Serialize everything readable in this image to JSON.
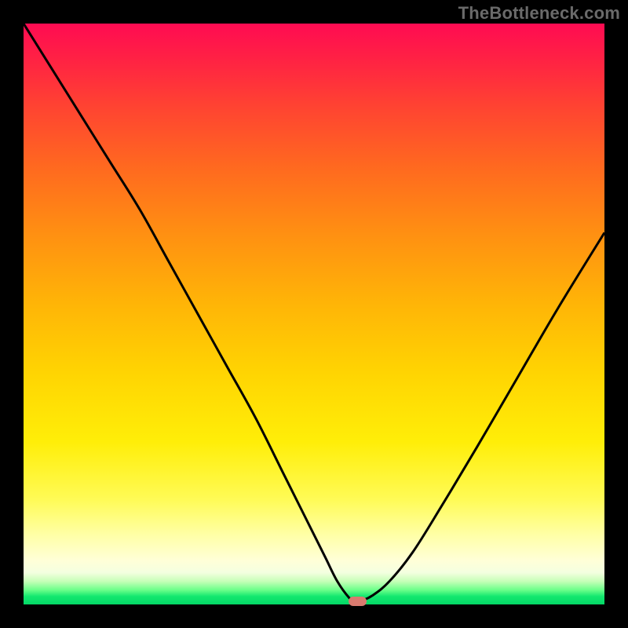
{
  "watermark_text": "TheBottleneck.com",
  "chart_data": {
    "type": "line",
    "title": "",
    "xlabel": "",
    "ylabel": "",
    "xlim": [
      0,
      100
    ],
    "ylim": [
      0,
      100
    ],
    "series": [
      {
        "name": "bottleneck-curve",
        "x": [
          0,
          5,
          10,
          15,
          20,
          25,
          30,
          35,
          40,
          45,
          50,
          52,
          54,
          56,
          57,
          58,
          60,
          63,
          67,
          72,
          78,
          85,
          92,
          100
        ],
        "y": [
          100,
          92,
          84,
          76,
          68,
          59,
          50,
          41,
          32,
          22,
          12,
          8,
          4,
          1.2,
          0.6,
          0.6,
          1.5,
          4,
          9,
          17,
          27,
          39,
          51,
          64
        ]
      }
    ],
    "minimum_marker": {
      "x": 57.5,
      "y": 0.5,
      "color": "#d97a6f",
      "w_pct": 3.2,
      "h_pct": 1.6
    },
    "gradient_note": "Background vertical gradient from red/magenta (top, high bottleneck) through orange and yellow to green (bottom, no bottleneck)."
  },
  "colors": {
    "frame": "#000000",
    "curve": "#000000",
    "watermark": "#6a6a6a",
    "marker": "#d97a6f"
  }
}
